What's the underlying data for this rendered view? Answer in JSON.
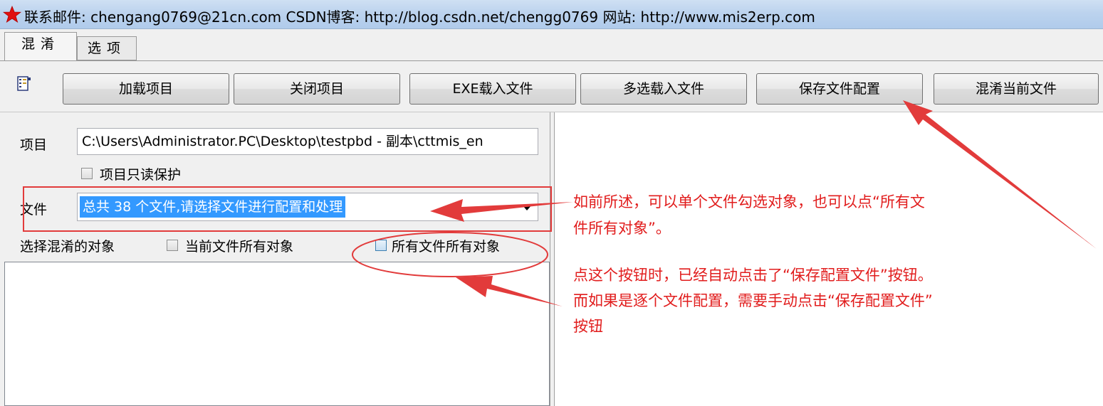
{
  "window": {
    "title": "联系邮件: chengang0769@21cn.com  CSDN博客: http://blog.csdn.net/chengg0769  网站: http://www.mis2erp.com",
    "icon": "red-star-icon"
  },
  "tabs": [
    {
      "label": "混淆",
      "active": true
    },
    {
      "label": "选项",
      "active": false
    }
  ],
  "toolbar": {
    "icon": "properties-icon",
    "buttons": [
      "加载项目",
      "关闭项目",
      "EXE载入文件",
      "多选载入文件",
      "保存文件配置",
      "混淆当前文件"
    ]
  },
  "form": {
    "project_label": "项目",
    "project_value": "C:\\Users\\Administrator.PC\\Desktop\\testpbd - 副本\\cttmis_en",
    "readonly_label": "项目只读保护",
    "file_label": "文件",
    "file_selected": "总共 38 个文件,请选择文件进行配置和处理",
    "objects_label": "选择混淆的对象",
    "current_file_all_label": "当前文件所有对象",
    "all_files_all_label": "所有文件所有对象"
  },
  "annotations": {
    "note1": "如前所述，可以单个文件勾选对象，也可以点“所有文件所有对象”。",
    "note1_line1": "如前所述，可以单个文件勾选对象，也可以点“所有文",
    "note1_line2": "件所有对象”。",
    "note2_line1": "点这个按钮时，已经自动点击了“保存配置文件”按钮。",
    "note2_line2": "而如果是逐个文件配置，需要手动点击“保存配置文件”",
    "note2_line3": "按钮",
    "color": "#e11c1c"
  }
}
